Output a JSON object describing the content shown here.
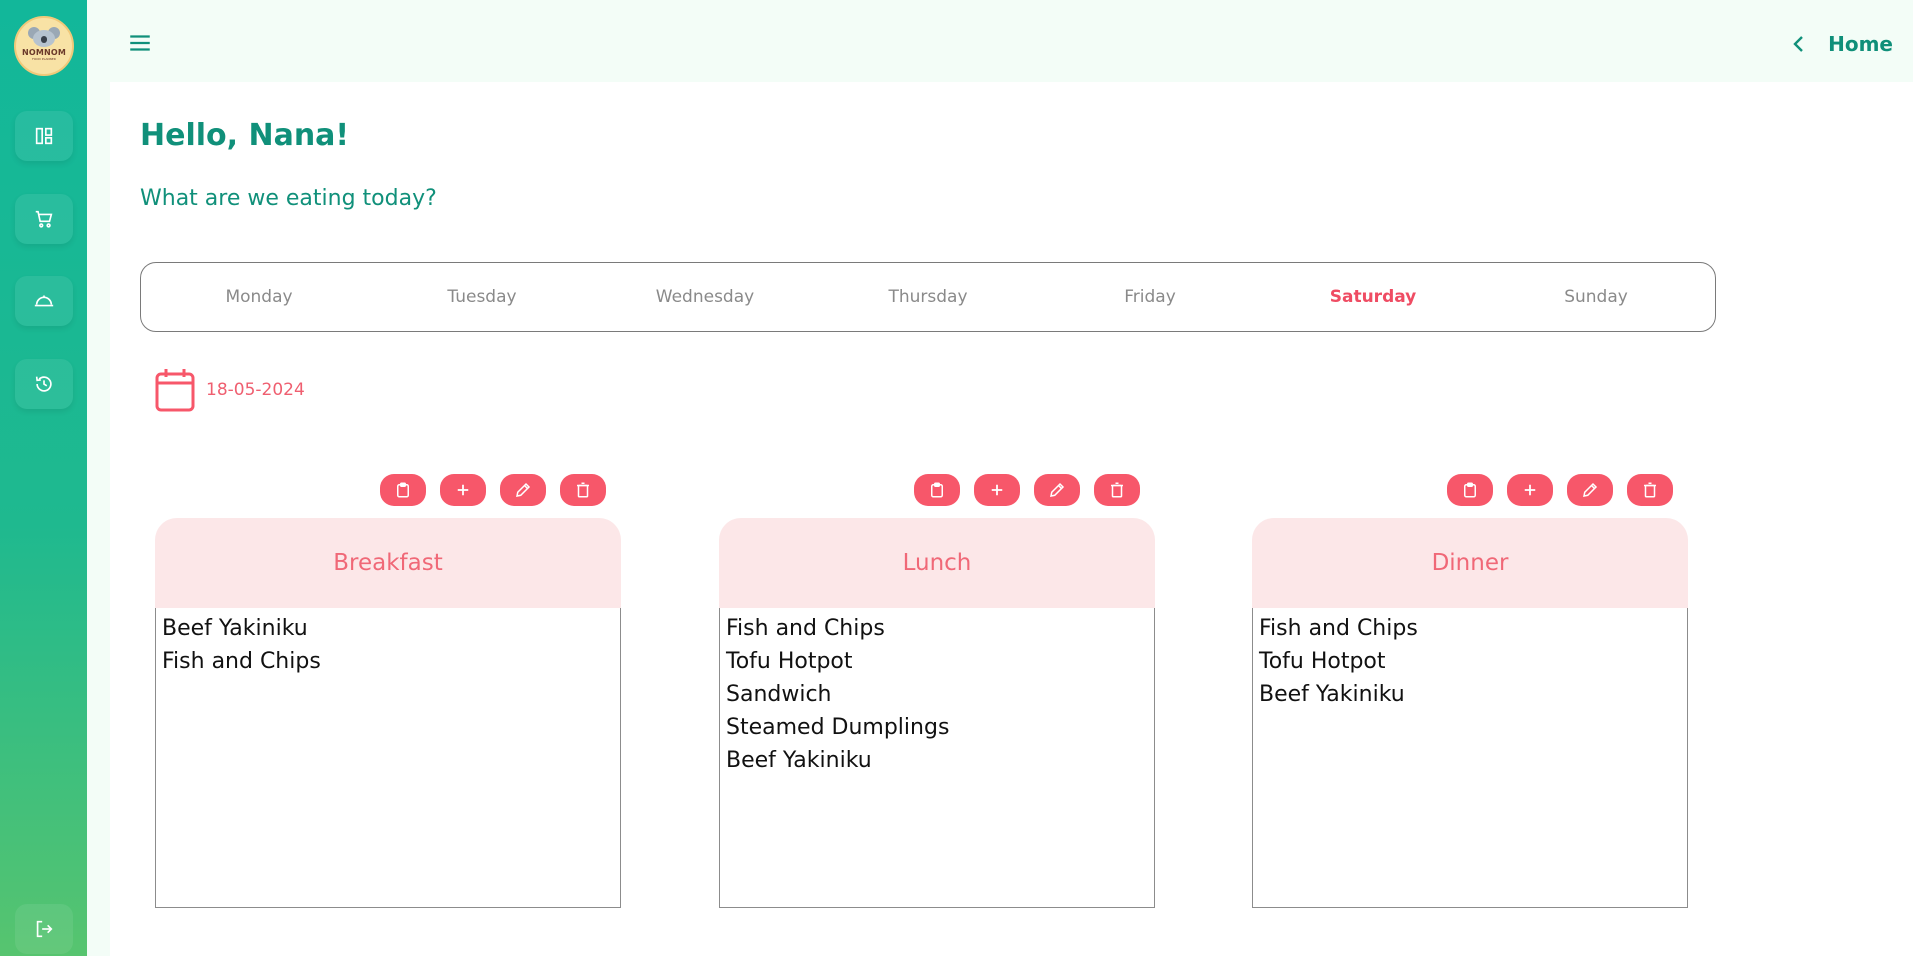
{
  "brand": {
    "name": "NOMNOM",
    "tagline": "FOOD PLANNER"
  },
  "topbar": {
    "home_label": "Home"
  },
  "greeting": "Hello, Nana!",
  "subtitle": "What are we eating today?",
  "days": [
    "Monday",
    "Tuesday",
    "Wednesday",
    "Thursday",
    "Friday",
    "Saturday",
    "Sunday"
  ],
  "active_day": "Saturday",
  "date": "18-05-2024",
  "meals": [
    {
      "title": "Breakfast",
      "items": [
        "Beef Yakiniku",
        "Fish and Chips"
      ]
    },
    {
      "title": "Lunch",
      "items": [
        "Fish and Chips",
        "Tofu Hotpot",
        "Sandwich",
        "Steamed Dumplings",
        "Beef Yakiniku"
      ]
    },
    {
      "title": "Dinner",
      "items": [
        "Fish and Chips",
        "Tofu Hotpot",
        "Beef Yakiniku"
      ]
    }
  ],
  "sidebar_items": [
    "dashboard-icon",
    "cart-icon",
    "cloche-icon",
    "history-icon"
  ],
  "meal_actions": [
    "clipboard-icon",
    "plus-icon",
    "pencil-icon",
    "trash-icon"
  ],
  "colors": {
    "primary": "#10907a",
    "accent": "#f7576a",
    "card_head": "#fce7e8"
  }
}
